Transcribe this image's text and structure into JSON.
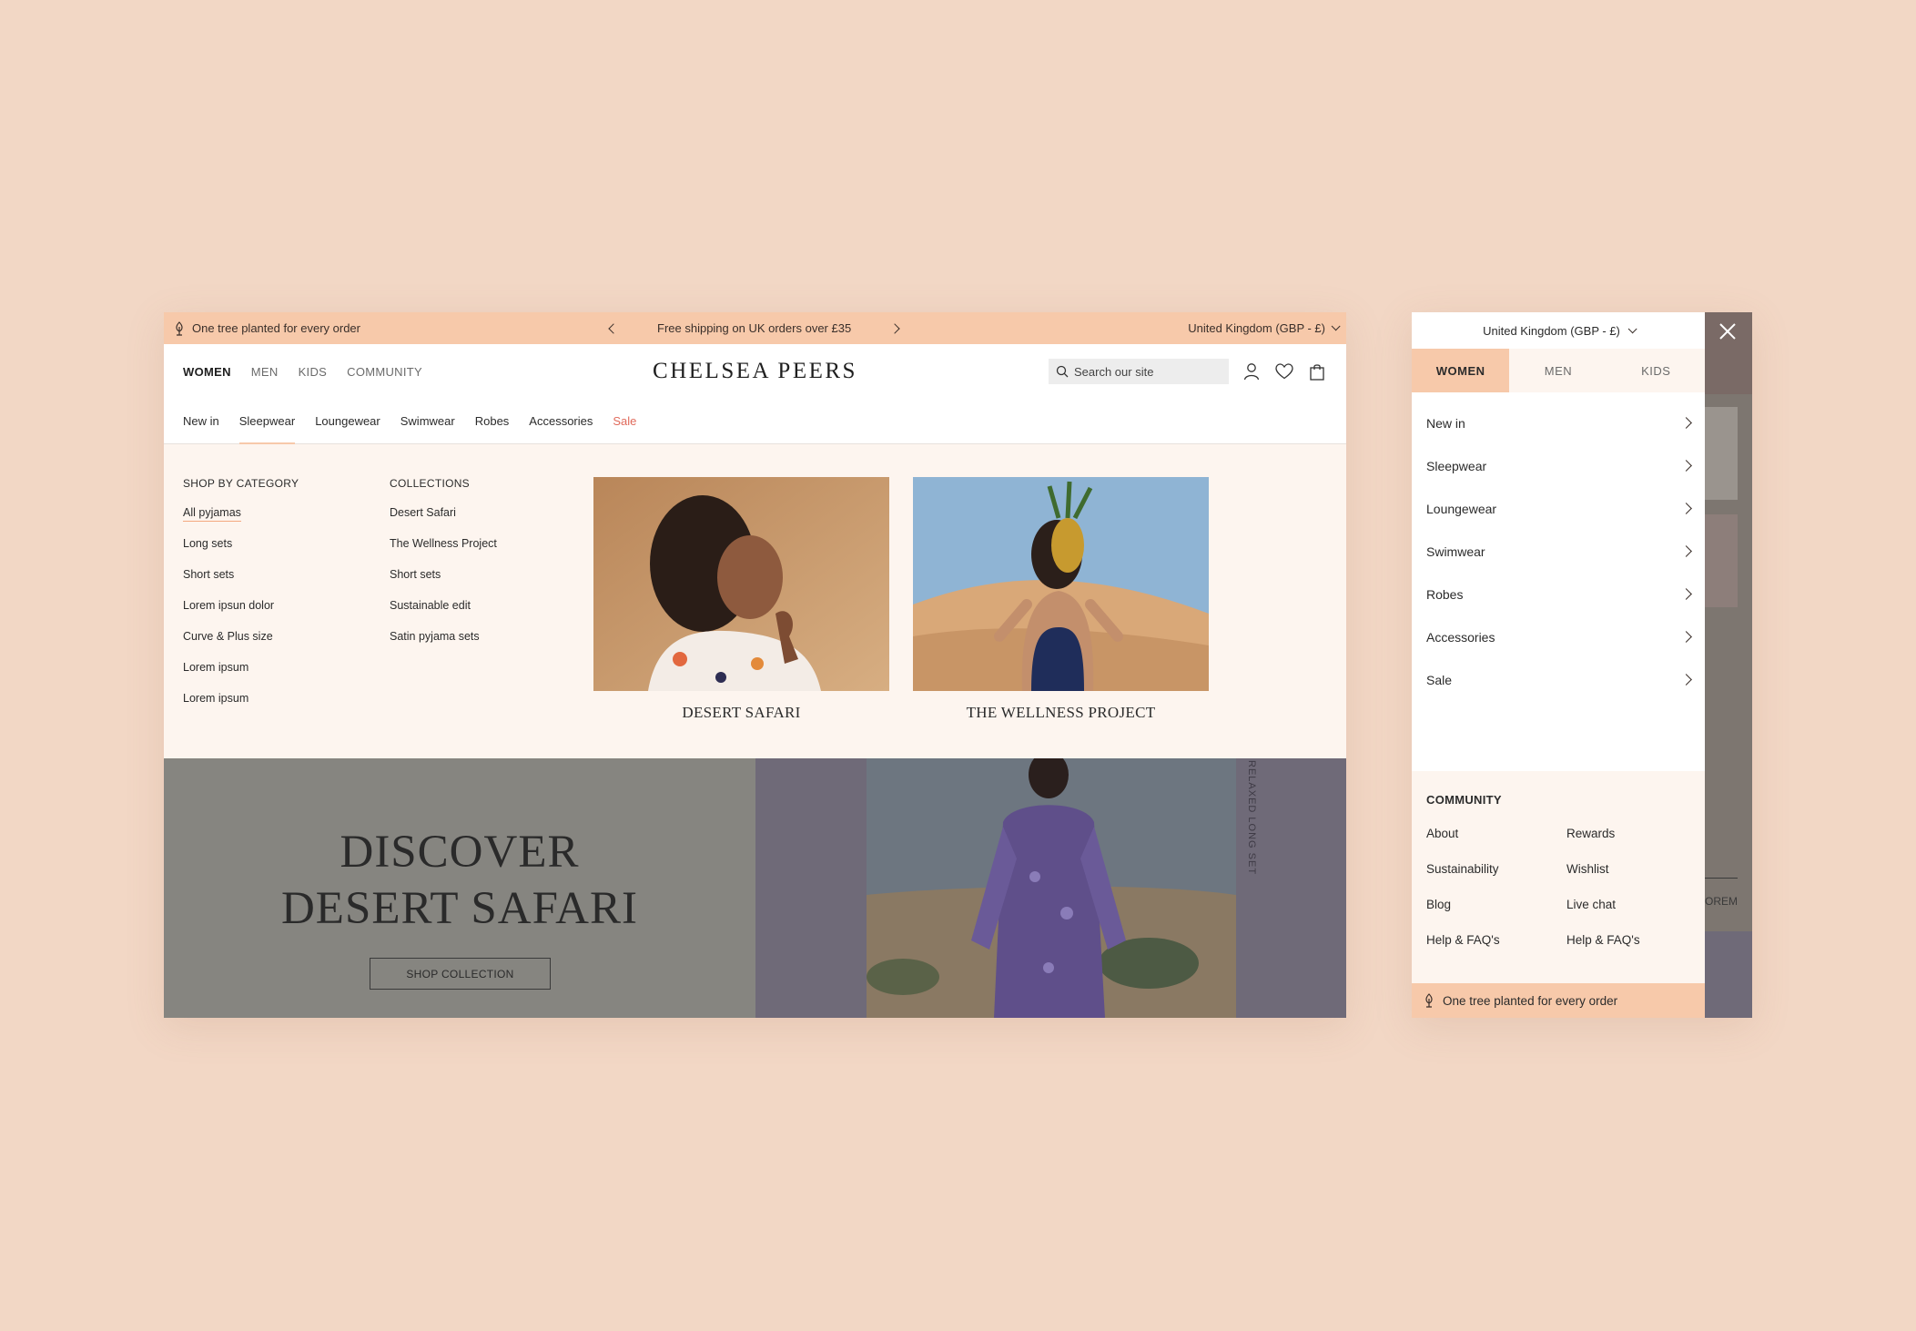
{
  "colors": {
    "page_bg": "#f2d7c5",
    "promo_bg": "#f7c9aa",
    "mega_bg": "#fdf5ef",
    "sale_red": "#e06a5b",
    "accent_underline": "#f4a980"
  },
  "desktop": {
    "promo": {
      "left_text": "One tree planted for every order",
      "center_text": "Free shipping on UK orders over £35",
      "region": "United Kingdom (GBP - £)"
    },
    "gender_tabs": [
      "WOMEN",
      "MEN",
      "KIDS",
      "COMMUNITY"
    ],
    "logo": "CHELSEA PEERS",
    "search_placeholder": "Search our site",
    "categories": [
      "New in",
      "Sleepwear",
      "Loungewear",
      "Swimwear",
      "Robes",
      "Accessories",
      "Sale"
    ],
    "mega": {
      "shop_by_category": {
        "heading": "SHOP BY CATEGORY",
        "items": [
          "All pyjamas",
          "Long sets",
          "Short sets",
          "Lorem ipsun dolor",
          "Curve & Plus size",
          "Lorem ipsum",
          "Lorem ipsum"
        ]
      },
      "collections": {
        "heading": "COLLECTIONS",
        "items": [
          "Desert Safari",
          "The Wellness Project",
          "Short sets",
          "Sustainable edit",
          "Satin pyjama sets"
        ]
      },
      "cards": [
        {
          "caption": "DESERT SAFARI"
        },
        {
          "caption": "THE WELLNESS PROJECT"
        }
      ]
    },
    "hero": {
      "title_line1": "DISCOVER",
      "title_line2": "DESERT SAFARI",
      "button": "SHOP COLLECTION",
      "vertical_text": "RELAXED LONG SET"
    }
  },
  "mobile": {
    "region": "United Kingdom (GBP - £)",
    "tabs": [
      "WOMEN",
      "MEN",
      "KIDS"
    ],
    "menu": [
      "New in",
      "Sleepwear",
      "Loungewear",
      "Swimwear",
      "Robes",
      "Accessories",
      "Sale"
    ],
    "community": {
      "heading": "COMMUNITY",
      "links": [
        "About",
        "Rewards",
        "Sustainability",
        "Wishlist",
        "Blog",
        "Live chat",
        "Help & FAQ's",
        "Help & FAQ's"
      ]
    },
    "footer_text": "One tree planted for every order",
    "bg_partial_text": "LOREM"
  }
}
